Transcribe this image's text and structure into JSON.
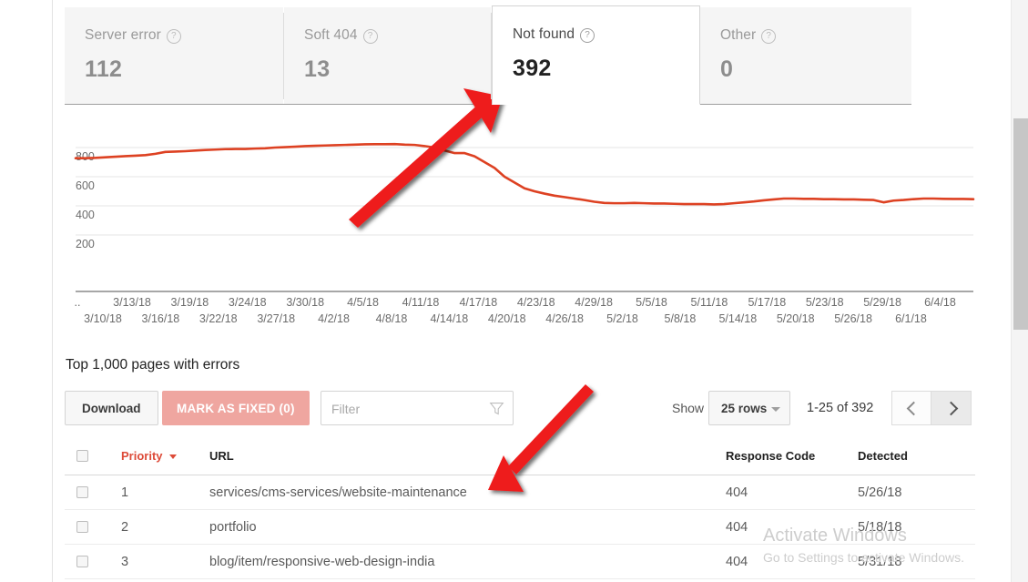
{
  "tabs": [
    {
      "label": "Server error",
      "value": "112",
      "active": false,
      "help": "help-icon"
    },
    {
      "label": "Soft 404",
      "value": "13",
      "active": false,
      "help": "help-icon"
    },
    {
      "label": "Not found",
      "value": "392",
      "active": true,
      "help": "help-icon"
    },
    {
      "label": "Other",
      "value": "0",
      "active": false,
      "help": "help-icon"
    }
  ],
  "section": {
    "title": "Top 1,000 pages with errors"
  },
  "toolbar": {
    "download_label": "Download",
    "mark_fixed_label": "MARK AS FIXED (0)",
    "filter_placeholder": "Filter",
    "filter_value": "",
    "show_label": "Show",
    "rows_value": "25 rows",
    "range_label": "1-25 of 392",
    "prev_icon": "chevron-left-icon",
    "next_icon": "chevron-right-icon",
    "filter_icon": "funnel-icon"
  },
  "table": {
    "columns": [
      "",
      "Priority",
      "URL",
      "Response Code",
      "Detected"
    ],
    "sort_column": "Priority",
    "sort_direction": "desc",
    "rows": [
      {
        "priority": "1",
        "url": "services/cms-services/website-maintenance",
        "response_code": "404",
        "detected": "5/26/18"
      },
      {
        "priority": "2",
        "url": "portfolio",
        "response_code": "404",
        "detected": "5/18/18"
      },
      {
        "priority": "3",
        "url": "blog/item/responsive-web-design-india",
        "response_code": "404",
        "detected": "5/31/18"
      }
    ]
  },
  "watermark": {
    "title": "Activate Windows",
    "subtitle": "Go to Settings to activate Windows."
  },
  "chart_data": {
    "type": "line",
    "title": "",
    "xlabel": "",
    "ylabel": "",
    "ylim": [
      0,
      900
    ],
    "yticks": [
      200,
      400,
      600,
      800
    ],
    "grid": true,
    "legend": false,
    "line_color": "#dd4122",
    "leading_tick": "..",
    "x_top": [
      "3/13/18",
      "3/19/18",
      "3/24/18",
      "3/30/18",
      "4/5/18",
      "4/11/18",
      "4/17/18",
      "4/23/18",
      "4/29/18",
      "5/5/18",
      "5/11/18",
      "5/17/18",
      "5/23/18",
      "5/29/18",
      "6/4/18"
    ],
    "x_bottom": [
      "3/10/18",
      "3/16/18",
      "3/22/18",
      "3/27/18",
      "4/2/18",
      "4/8/18",
      "4/14/18",
      "4/20/18",
      "4/26/18",
      "5/2/18",
      "5/8/18",
      "5/14/18",
      "5/20/18",
      "5/26/18",
      "6/1/18"
    ],
    "x": [
      "3/8/18",
      "3/9/18",
      "3/10/18",
      "3/11/18",
      "3/12/18",
      "3/13/18",
      "3/14/18",
      "3/15/18",
      "3/16/18",
      "3/17/18",
      "3/18/18",
      "3/19/18",
      "3/20/18",
      "3/21/18",
      "3/22/18",
      "3/23/18",
      "3/24/18",
      "3/25/18",
      "3/26/18",
      "3/27/18",
      "3/28/18",
      "3/29/18",
      "3/30/18",
      "3/31/18",
      "4/1/18",
      "4/2/18",
      "4/3/18",
      "4/4/18",
      "4/5/18",
      "4/6/18",
      "4/7/18",
      "4/8/18",
      "4/9/18",
      "4/10/18",
      "4/11/18",
      "4/12/18",
      "4/13/18",
      "4/14/18",
      "4/15/18",
      "4/16/18",
      "4/17/18",
      "4/18/18",
      "4/19/18",
      "4/20/18",
      "4/21/18",
      "4/22/18",
      "4/23/18",
      "4/24/18",
      "4/25/18",
      "4/26/18",
      "4/27/18",
      "4/28/18",
      "4/29/18",
      "4/30/18",
      "5/1/18",
      "5/2/18",
      "5/3/18",
      "5/4/18",
      "5/5/18",
      "5/6/18",
      "5/7/18",
      "5/8/18",
      "5/9/18",
      "5/10/18",
      "5/11/18",
      "5/12/18",
      "5/13/18",
      "5/14/18",
      "5/15/18",
      "5/16/18",
      "5/17/18",
      "5/18/18",
      "5/19/18",
      "5/20/18",
      "5/21/18",
      "5/22/18",
      "5/23/18",
      "5/24/18",
      "5/25/18",
      "5/26/18",
      "5/27/18",
      "5/28/18",
      "5/29/18",
      "5/30/18",
      "5/31/18",
      "6/1/18",
      "6/2/18",
      "6/3/18",
      "6/4/18",
      "6/5/18"
    ],
    "values": [
      727,
      727,
      729,
      733,
      737,
      741,
      744,
      748,
      757,
      770,
      772,
      775,
      779,
      783,
      786,
      789,
      790,
      790,
      793,
      795,
      800,
      803,
      806,
      810,
      812,
      814,
      816,
      818,
      820,
      822,
      823,
      823,
      824,
      820,
      818,
      810,
      800,
      780,
      762,
      762,
      740,
      700,
      660,
      600,
      560,
      520,
      500,
      484,
      470,
      460,
      450,
      440,
      428,
      420,
      418,
      418,
      420,
      418,
      416,
      416,
      414,
      412,
      412,
      412,
      410,
      412,
      418,
      424,
      430,
      438,
      444,
      450,
      450,
      448,
      448,
      446,
      446,
      444,
      444,
      442,
      440,
      424,
      436,
      440,
      446,
      450,
      450,
      448,
      447,
      447,
      446
    ]
  }
}
